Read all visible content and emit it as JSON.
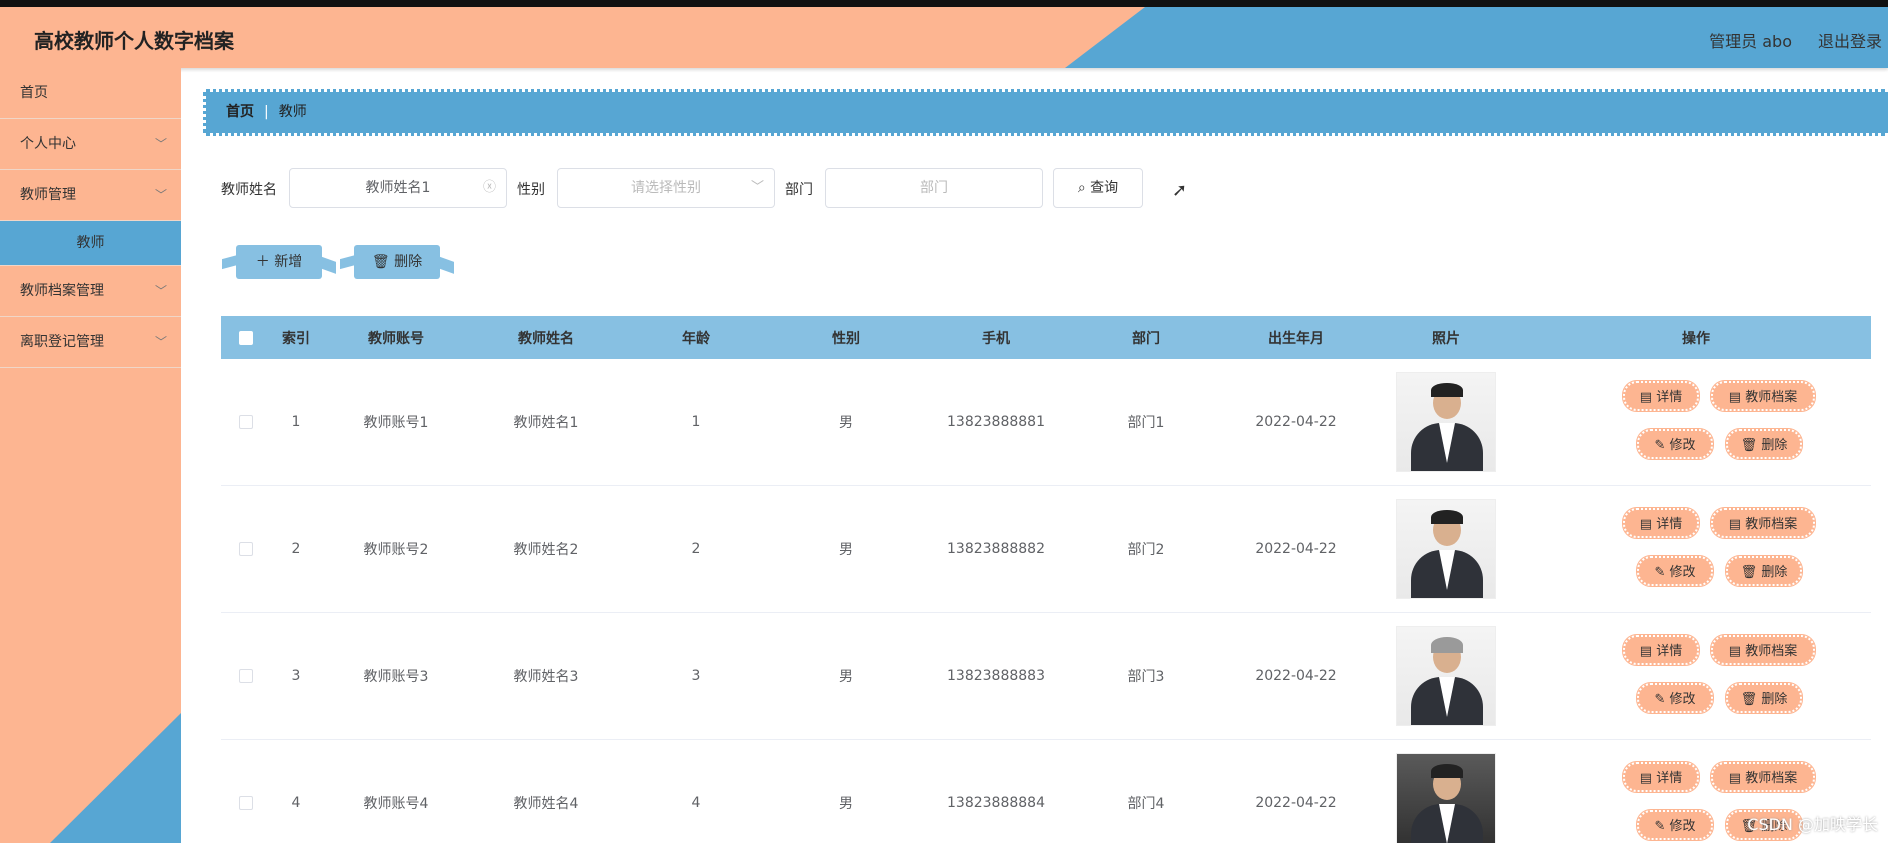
{
  "header": {
    "title": "高校教师个人数字档案",
    "user": "管理员 abo",
    "logout": "退出登录"
  },
  "sidebar": {
    "items": [
      {
        "label": "首页",
        "chevron": false
      },
      {
        "label": "个人中心",
        "chevron": true
      },
      {
        "label": "教师管理",
        "chevron": true
      },
      {
        "label": "教师",
        "chevron": false,
        "active": true
      },
      {
        "label": "教师档案管理",
        "chevron": true
      },
      {
        "label": "离职登记管理",
        "chevron": true
      }
    ]
  },
  "breadcrumb": {
    "home": "首页",
    "current": "教师"
  },
  "search": {
    "name_label": "教师姓名",
    "name_value": "教师姓名1",
    "gender_label": "性别",
    "gender_placeholder": "请选择性别",
    "dept_label": "部门",
    "dept_placeholder": "部门",
    "query_label": "查询"
  },
  "actions": {
    "add": "新增",
    "delete": "删除"
  },
  "table": {
    "headers": [
      "索引",
      "教师账号",
      "教师姓名",
      "年龄",
      "性别",
      "手机",
      "部门",
      "出生年月",
      "照片",
      "操作"
    ],
    "rows": [
      {
        "index": "1",
        "account": "教师账号1",
        "name": "教师姓名1",
        "age": "1",
        "gender": "男",
        "phone": "13823888881",
        "dept": "部门1",
        "birth": "2022-04-22"
      },
      {
        "index": "2",
        "account": "教师账号2",
        "name": "教师姓名2",
        "age": "2",
        "gender": "男",
        "phone": "13823888882",
        "dept": "部门2",
        "birth": "2022-04-22"
      },
      {
        "index": "3",
        "account": "教师账号3",
        "name": "教师姓名3",
        "age": "3",
        "gender": "男",
        "phone": "13823888883",
        "dept": "部门3",
        "birth": "2022-04-22"
      },
      {
        "index": "4",
        "account": "教师账号4",
        "name": "教师姓名4",
        "age": "4",
        "gender": "男",
        "phone": "13823888884",
        "dept": "部门4",
        "birth": "2022-04-22"
      }
    ],
    "ops": {
      "detail": "详情",
      "archive": "教师档案",
      "edit": "修改",
      "delete": "删除"
    }
  },
  "watermark": "CSDN @加映学长",
  "colors": {
    "peach": "#fdb591",
    "blue": "#57a6d3",
    "light_blue": "#87c0e2"
  }
}
